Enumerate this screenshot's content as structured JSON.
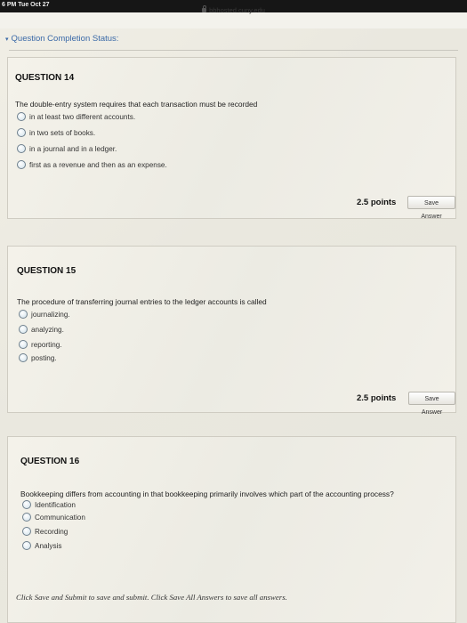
{
  "status_bar": {
    "time": "6 PM  Tue Oct 27"
  },
  "browser": {
    "url": "bbhosted.cuny.edu"
  },
  "completion_status": "Question Completion Status:",
  "questions": [
    {
      "title": "QUESTION 14",
      "prompt": "The double-entry system requires that each transaction must be recorded",
      "options": [
        "in at least two different accounts.",
        "in two sets of books.",
        "in a journal and in a ledger.",
        "first as a revenue and then as an expense."
      ],
      "points": "2.5 points",
      "save_label": "Save Answer"
    },
    {
      "title": "QUESTION 15",
      "prompt": "The procedure of transferring journal entries to the ledger accounts is called",
      "options": [
        "journalizing.",
        "analyzing.",
        "reporting.",
        "posting."
      ],
      "points": "2.5 points",
      "save_label": "Save Answer"
    },
    {
      "title": "QUESTION 16",
      "prompt": "Bookkeeping differs from accounting in that bookkeeping primarily involves which part of the accounting process?",
      "options": [
        "Identification",
        "Communication",
        "Recording",
        "Analysis"
      ]
    }
  ],
  "footer": "Click Save and Submit to save and submit. Click Save All Answers to save all answers."
}
